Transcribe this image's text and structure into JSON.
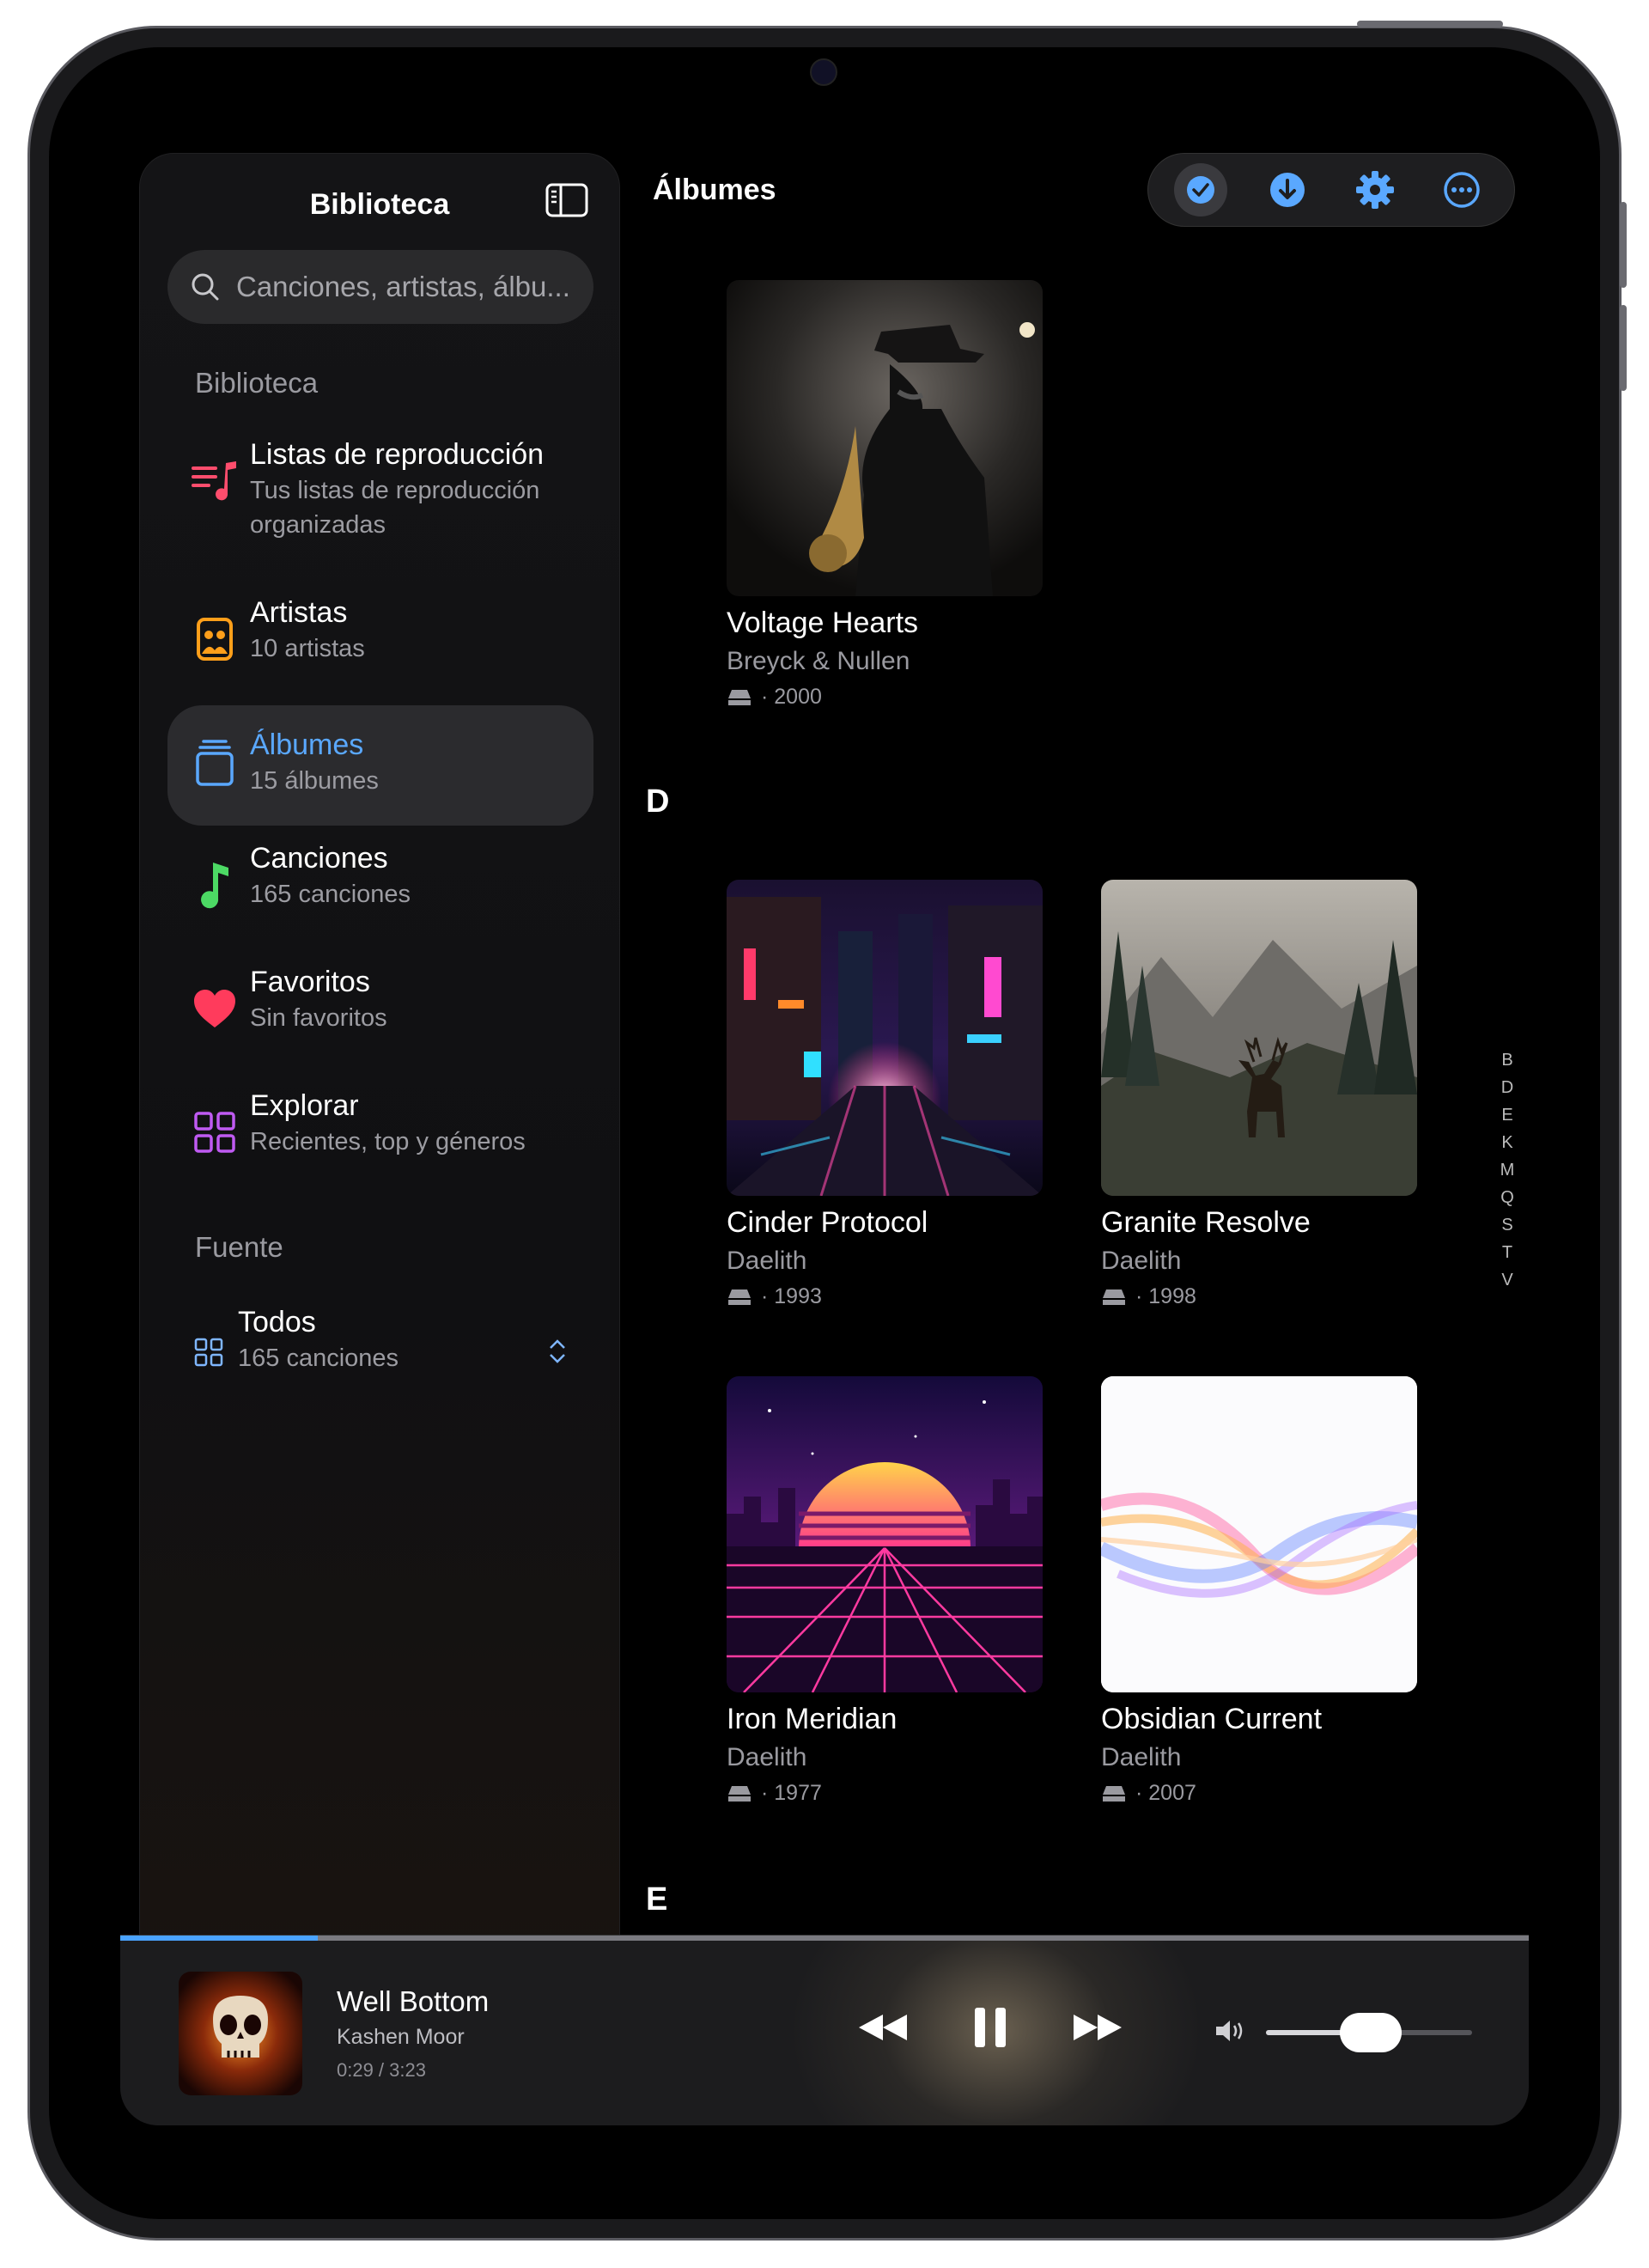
{
  "sidebar": {
    "title": "Biblioteca",
    "search_placeholder": "Canciones, artistas, álbu...",
    "section_library": "Biblioteca",
    "items": [
      {
        "title": "Listas de reproducción",
        "subtitle_line1": "Tus listas de reproducción",
        "subtitle_line2": "organizadas"
      },
      {
        "title": "Artistas",
        "subtitle": "10 artistas"
      },
      {
        "title": "Álbumes",
        "subtitle": "15 álbumes"
      },
      {
        "title": "Canciones",
        "subtitle": "165 canciones"
      },
      {
        "title": "Favoritos",
        "subtitle": "Sin favoritos"
      },
      {
        "title": "Explorar",
        "subtitle": "Recientes, top y géneros"
      }
    ],
    "section_source": "Fuente",
    "source": {
      "title": "Todos",
      "subtitle": "165 canciones"
    }
  },
  "main": {
    "title": "Álbumes",
    "toolbar": [
      "checkmark-icon",
      "download-icon",
      "gear-icon",
      "more-icon"
    ],
    "albums": [
      {
        "title": "Voltage Hearts",
        "artist": "Breyck & Nullen",
        "separator": "·",
        "year": "2000"
      },
      {
        "title": "Cinder Protocol",
        "artist": "Daelith",
        "separator": "·",
        "year": "1993"
      },
      {
        "title": "Granite Resolve",
        "artist": "Daelith",
        "separator": "·",
        "year": "1998"
      },
      {
        "title": "Iron Meridian",
        "artist": "Daelith",
        "separator": "·",
        "year": "1977"
      },
      {
        "title": "Obsidian Current",
        "artist": "Daelith",
        "separator": "·",
        "year": "2007"
      }
    ],
    "sections": [
      "D",
      "E"
    ],
    "index": [
      "B",
      "D",
      "E",
      "K",
      "M",
      "Q",
      "S",
      "T",
      "V"
    ]
  },
  "player": {
    "title": "Well Bottom",
    "artist": "Kashen Moor",
    "time": "0:29 / 3:23",
    "progress": 0.14,
    "volume": 0.52
  },
  "colors": {
    "accent": "#4aa3ff",
    "playlist": "#ff4d6d",
    "artists": "#ff9f1a",
    "songs": "#4cd964",
    "favorites": "#ff3b5c",
    "explore": "#bf5af2"
  }
}
